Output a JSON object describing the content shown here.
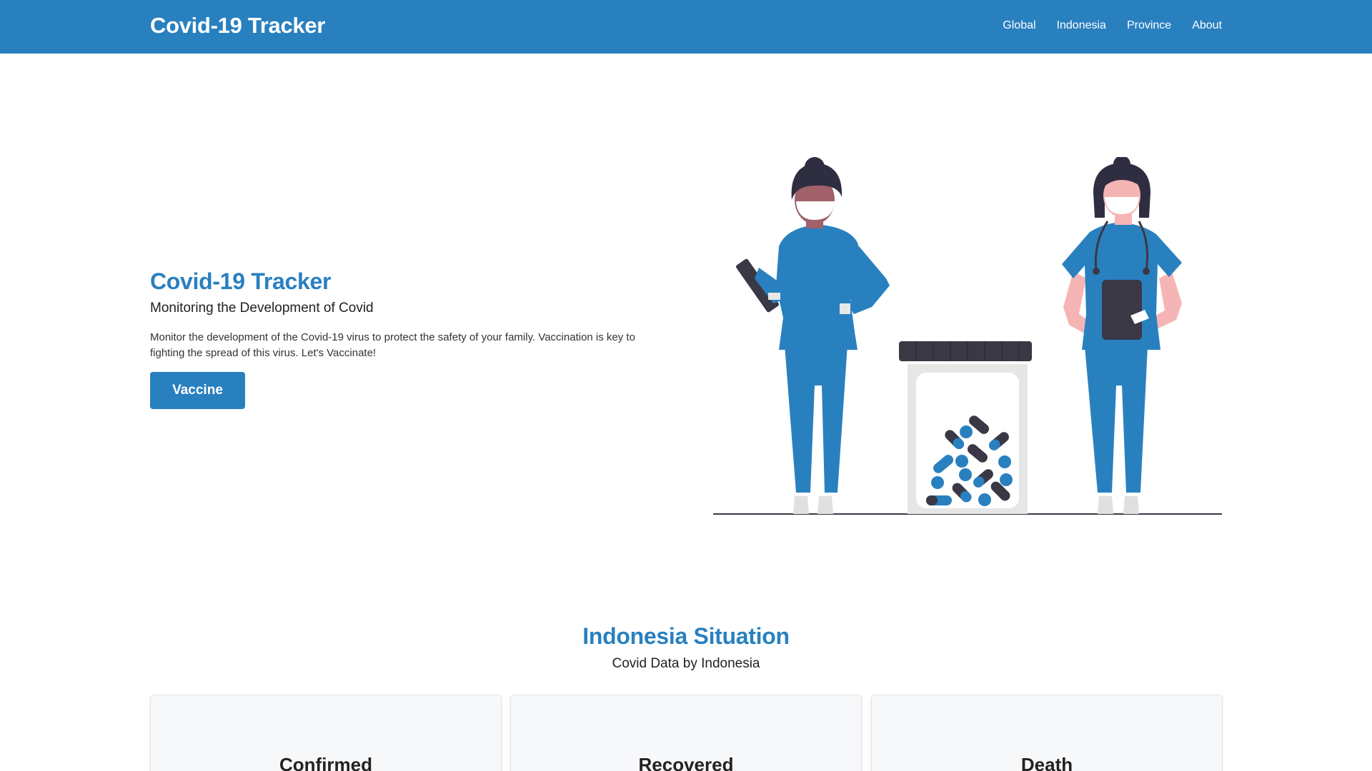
{
  "navbar": {
    "brand": "Covid-19 Tracker",
    "links": [
      "Global",
      "Indonesia",
      "Province",
      "About"
    ]
  },
  "hero": {
    "title": "Covid-19 Tracker",
    "subtitle": "Monitoring the Development of Covid",
    "description": "Monitor the development of the Covid-19 virus to protect the safety of your family. Vaccination is key to fighting the spread of this virus. Let's Vaccinate!",
    "button": "Vaccine"
  },
  "situation": {
    "title": "Indonesia Situation",
    "subtitle": "Covid Data by Indonesia",
    "cards": [
      "Confirmed",
      "Recovered",
      "Death"
    ]
  },
  "colors": {
    "primary": "#2980bf",
    "dark": "#3a3845",
    "skin_dark": "#a0616a",
    "skin_light": "#f6b5b5"
  },
  "icons": {
    "illustration": "doctors-with-pill-jar-illustration"
  }
}
